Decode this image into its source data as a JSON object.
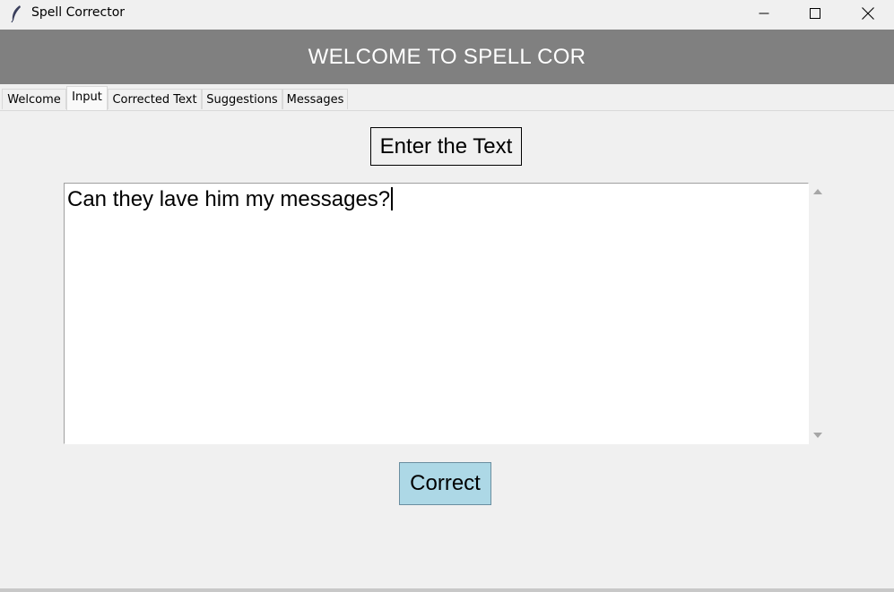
{
  "window": {
    "title": "Spell Corrector",
    "icon": "feather-icon"
  },
  "banner": {
    "text": "WELCOME TO SPELL COR",
    "background": "#808080"
  },
  "tabs": [
    {
      "label": "Welcome",
      "active": false
    },
    {
      "label": "Input",
      "active": true
    },
    {
      "label": "Corrected Text",
      "active": false
    },
    {
      "label": "Suggestions",
      "active": false
    },
    {
      "label": "Messages",
      "active": false
    }
  ],
  "main": {
    "prompt_label": "Enter the Text",
    "input_text": "Can they lave him my messages?",
    "correct_button_label": "Correct",
    "button_color": "#add8e6"
  }
}
